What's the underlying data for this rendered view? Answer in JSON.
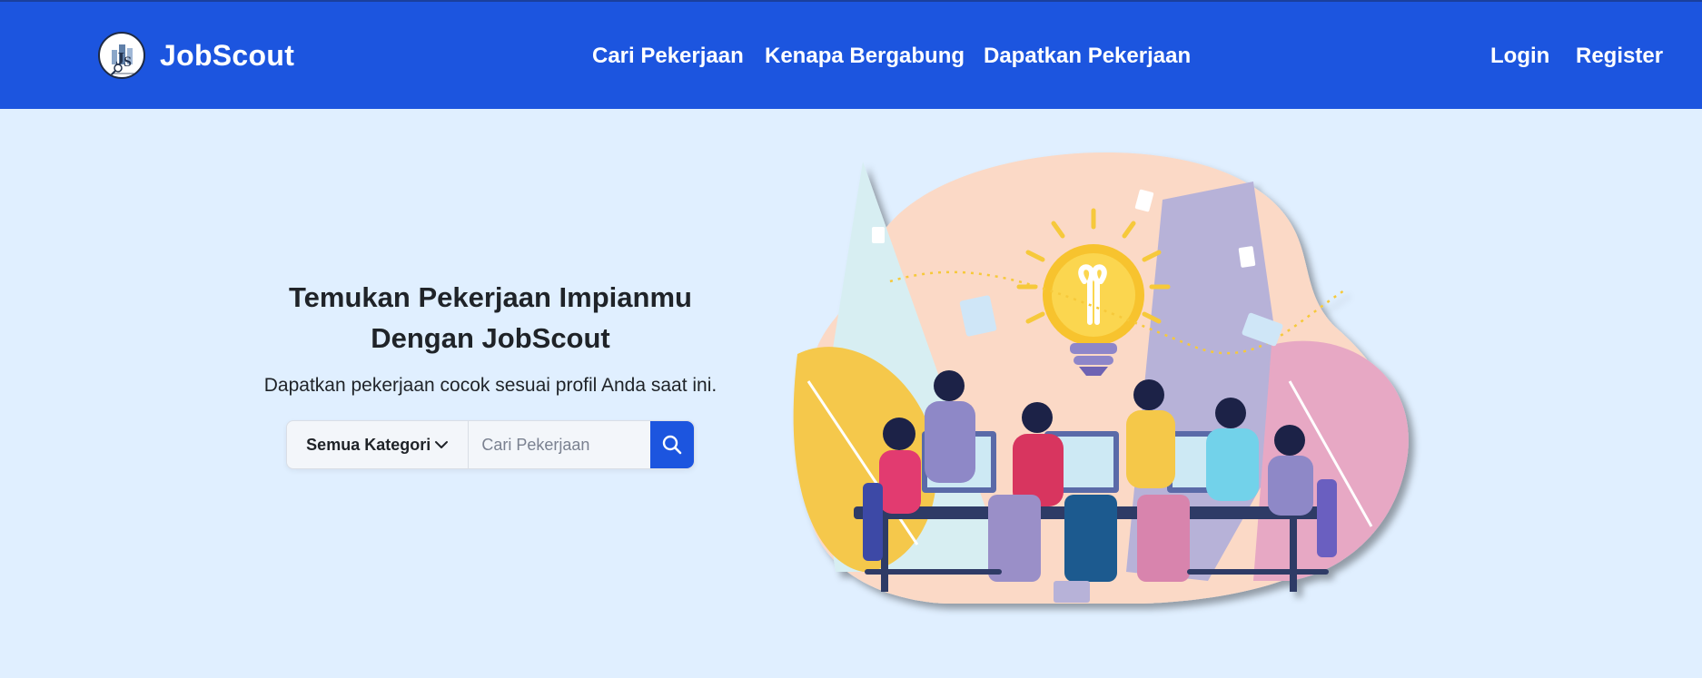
{
  "nav": {
    "brand": "JobScout",
    "links": [
      "Cari Pekerjaan",
      "Kenapa Bergabung",
      "Dapatkan Pekerjaan"
    ],
    "login": "Login",
    "register": "Register"
  },
  "hero": {
    "title_line1": "Temukan Pekerjaan Impianmu",
    "title_line2": "Dengan JobScout",
    "subtitle": "Dapatkan pekerjaan cocok sesuai profil Anda saat ini."
  },
  "search": {
    "category": "Semua Kategori",
    "placeholder": "Cari Pekerjaan",
    "value": ""
  },
  "colors": {
    "nav_bg": "#1c55df",
    "page_bg": "#e0efff",
    "accent": "#1c55df"
  },
  "icons": {
    "logo": "jobscout-logo",
    "chevron": "chevron-down-icon",
    "search": "search-icon",
    "illustration": "team-collaboration-illustration"
  }
}
